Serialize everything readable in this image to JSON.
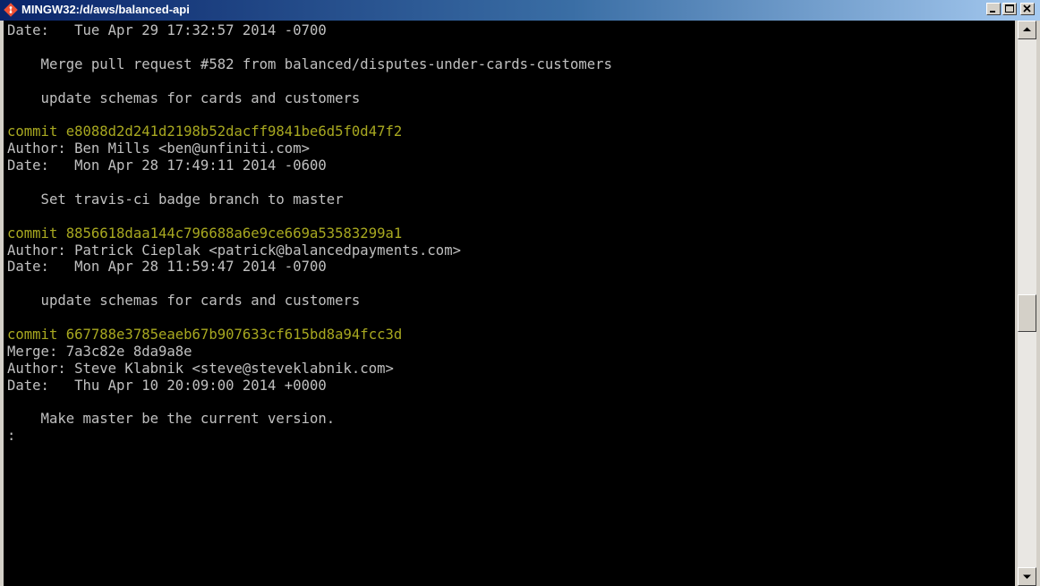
{
  "window": {
    "title": "MINGW32:/d/aws/balanced-api",
    "icon": "git-icon",
    "controls": [
      "minimize-icon",
      "maximize-icon",
      "close-icon"
    ]
  },
  "colors": {
    "terminal_bg": "#000000",
    "text": "#c0c0c0",
    "commit_hash": "#a8a820",
    "titlebar_start": "#0a246a",
    "titlebar_end": "#a6caf0"
  },
  "terminal": {
    "lines": [
      {
        "text": "Date:   Tue Apr 29 17:32:57 2014 -0700",
        "kind": "text"
      },
      {
        "text": "",
        "kind": "text"
      },
      {
        "text": "    Merge pull request #582 from balanced/disputes-under-cards-customers",
        "kind": "text"
      },
      {
        "text": "",
        "kind": "text"
      },
      {
        "text": "    update schemas for cards and customers",
        "kind": "text"
      },
      {
        "text": "",
        "kind": "text"
      },
      {
        "text": "commit e8088d2d241d2198b52dacff9841be6d5f0d47f2",
        "kind": "commit"
      },
      {
        "text": "Author: Ben Mills <ben@unfiniti.com>",
        "kind": "text"
      },
      {
        "text": "Date:   Mon Apr 28 17:49:11 2014 -0600",
        "kind": "text"
      },
      {
        "text": "",
        "kind": "text"
      },
      {
        "text": "    Set travis-ci badge branch to master",
        "kind": "text"
      },
      {
        "text": "",
        "kind": "text"
      },
      {
        "text": "commit 8856618daa144c796688a6e9ce669a53583299a1",
        "kind": "commit"
      },
      {
        "text": "Author: Patrick Cieplak <patrick@balancedpayments.com>",
        "kind": "text"
      },
      {
        "text": "Date:   Mon Apr 28 11:59:47 2014 -0700",
        "kind": "text"
      },
      {
        "text": "",
        "kind": "text"
      },
      {
        "text": "    update schemas for cards and customers",
        "kind": "text"
      },
      {
        "text": "",
        "kind": "text"
      },
      {
        "text": "commit 667788e3785eaeb67b907633cf615bd8a94fcc3d",
        "kind": "commit"
      },
      {
        "text": "Merge: 7a3c82e 8da9a8e",
        "kind": "text"
      },
      {
        "text": "Author: Steve Klabnik <steve@steveklabnik.com>",
        "kind": "text"
      },
      {
        "text": "Date:   Thu Apr 10 20:09:00 2014 +0000",
        "kind": "text"
      },
      {
        "text": "",
        "kind": "text"
      },
      {
        "text": "    Make master be the current version.",
        "kind": "text"
      },
      {
        "text": ":",
        "kind": "text"
      }
    ]
  },
  "scrollbar": {
    "position_fraction": 0.52
  }
}
